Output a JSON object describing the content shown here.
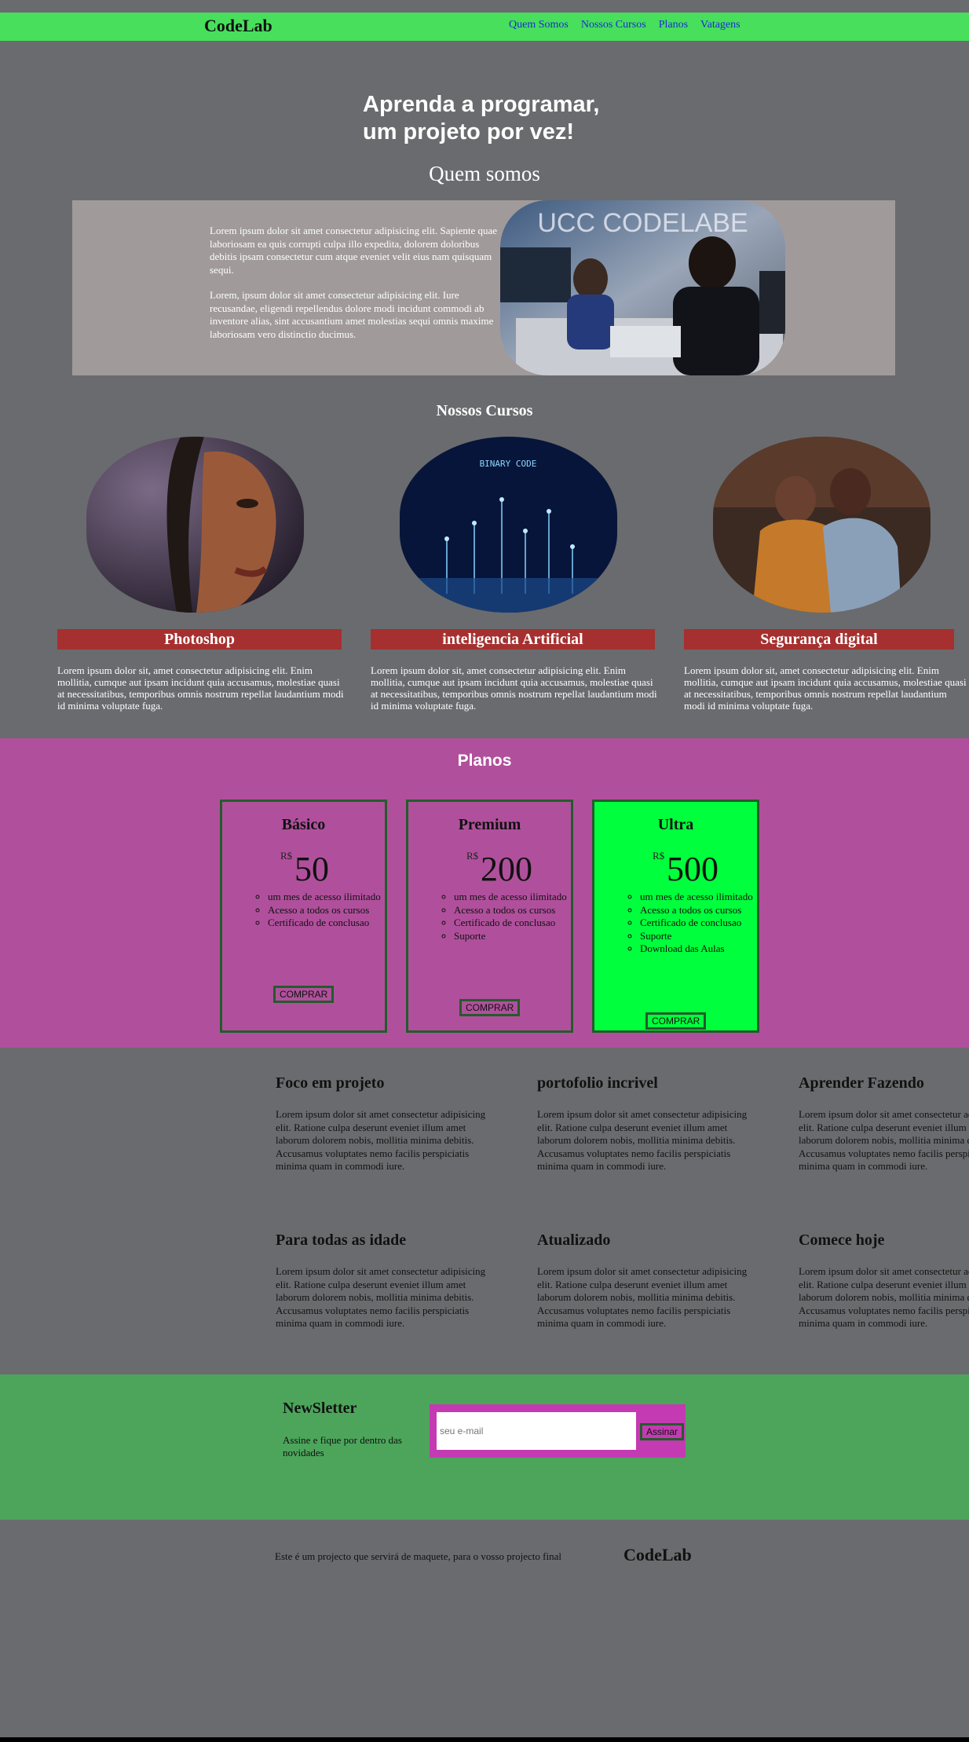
{
  "header": {
    "logo": "CodeLab",
    "nav": [
      "Quem Somos",
      "Nossos Cursos",
      "Planos",
      "Vatagens"
    ]
  },
  "hero": {
    "line1": "Aprenda a programar,",
    "line2": "um projeto por vez!"
  },
  "about": {
    "title": "Quem somos",
    "p1": "Lorem ipsum dolor sit amet consectetur adipisicing elit. Sapiente quae laboriosam ea quis corrupti culpa illo expedita, dolorem doloribus debitis ipsam consectetur cum atque eveniet velit eius nam quisquam sequi.",
    "p2": "Lorem, ipsum dolor sit amet consectetur adipisicing elit. Iure recusandae, eligendi repellendus dolore modi incidunt commodi ab inventore alias, sint accusantium amet molestias sequi omnis maxime laboriosam vero distinctio ducimus.",
    "image_title": "UCC CODELABE"
  },
  "courses": {
    "title": "Nossos Cursos",
    "items": [
      {
        "name": "Photoshop",
        "desc": "Lorem ipsum dolor sit, amet consectetur adipisicing elit. Enim mollitia, cumque aut ipsam incidunt quia accusamus, molestiae quasi at necessitatibus, temporibus omnis nostrum repellat laudantium modi id minima voluptate fuga."
      },
      {
        "name": "inteligencia Artificial",
        "desc": "Lorem ipsum dolor sit, amet consectetur adipisicing elit. Enim mollitia, cumque aut ipsam incidunt quia accusamus, molestiae quasi at necessitatibus, temporibus omnis nostrum repellat laudantium modi id minima voluptate fuga."
      },
      {
        "name": "Segurança digital",
        "desc": "Lorem ipsum dolor sit, amet consectetur adipisicing elit. Enim mollitia, cumque aut ipsam incidunt quia accusamus, molestiae quasi at necessitatibus, temporibus omnis nostrum repellat laudantium modi id minima voluptate fuga."
      }
    ],
    "ai_image_text": "BINARY CODE"
  },
  "plans": {
    "title": "Planos",
    "currency": "R$",
    "buy_label": "COMPRAR",
    "items": [
      {
        "name": "Básico",
        "price": "50",
        "features": [
          "um mes de acesso ilimitado",
          "Acesso a todos os cursos",
          "Certificado de conclusao"
        ]
      },
      {
        "name": "Premium",
        "price": "200",
        "features": [
          "um mes de acesso ilimitado",
          "Acesso a todos os cursos",
          "Certificado de conclusao",
          "Suporte"
        ]
      },
      {
        "name": "Ultra",
        "price": "500",
        "features": [
          "um mes de acesso ilimitado",
          "Acesso a todos os cursos",
          "Certificado de conclusao",
          "Suporte",
          "Download das Aulas"
        ]
      }
    ]
  },
  "features": {
    "text": "Lorem ipsum dolor sit amet consectetur adipisicing elit. Ratione culpa deserunt eveniet illum amet laborum dolorem nobis, mollitia minima debitis. Accusamus voluptates nemo facilis perspiciatis minima quam in commodi iure.",
    "items": [
      "Foco em projeto",
      "portofolio incrivel",
      "Aprender Fazendo",
      "Para todas as idade",
      "Atualizado",
      "Comece hoje"
    ]
  },
  "newsletter": {
    "title": "NewSletter",
    "subtitle": "Assine e fique por dentro das novidades",
    "placeholder": "seu e-mail",
    "button": "Assinar"
  },
  "footer": {
    "text": "Este é um projecto que servirá de maquete, para o vosso projecto final",
    "logo": "CodeLab"
  },
  "colors": {
    "page_bg": "#6a6b6e",
    "navbar": "#47df5c",
    "about_panel": "#a09a9a",
    "course_bar": "#a5302f",
    "plans_bg": "#b0509c",
    "plan_ultra": "#00ff3c",
    "plan_border": "#245b2c",
    "newsletter_bg": "#4ca55b",
    "newsletter_form": "#c43ab2"
  }
}
